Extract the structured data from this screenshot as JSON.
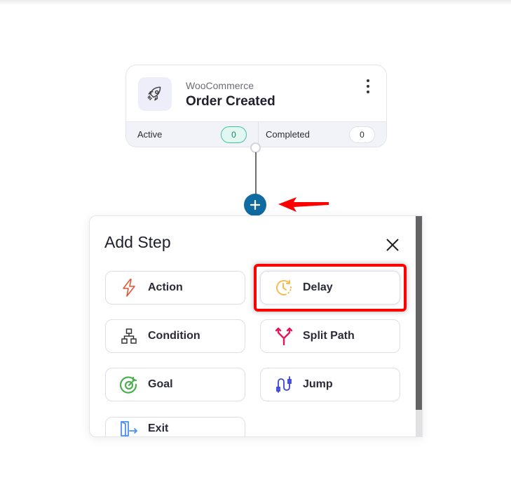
{
  "trigger": {
    "source": "WooCommerce",
    "title": "Order Created",
    "icon": "rocket-icon",
    "stats": [
      {
        "label": "Active",
        "count": "0"
      },
      {
        "label": "Completed",
        "count": "0"
      }
    ]
  },
  "add_step_panel": {
    "title": "Add Step",
    "close_icon": "close-icon",
    "options": [
      {
        "label": "Action",
        "icon": "lightning-icon",
        "color": "#e2543a"
      },
      {
        "label": "Delay",
        "icon": "clock-icon",
        "color": "#f5bd4f",
        "highlighted": true
      },
      {
        "label": "Condition",
        "icon": "hierarchy-icon",
        "color": "#333333"
      },
      {
        "label": "Split Path",
        "icon": "split-arrow-icon",
        "color": "#e8175d"
      },
      {
        "label": "Goal",
        "icon": "target-icon",
        "color": "#4caf50"
      },
      {
        "label": "Jump",
        "icon": "jump-icon",
        "color": "#3a44d6"
      },
      {
        "label": "Exit",
        "icon": "exit-door-icon",
        "color": "#4a8ef0"
      }
    ]
  },
  "colors": {
    "add_button": "#0f6ba1",
    "annotation": "#ff0000"
  }
}
